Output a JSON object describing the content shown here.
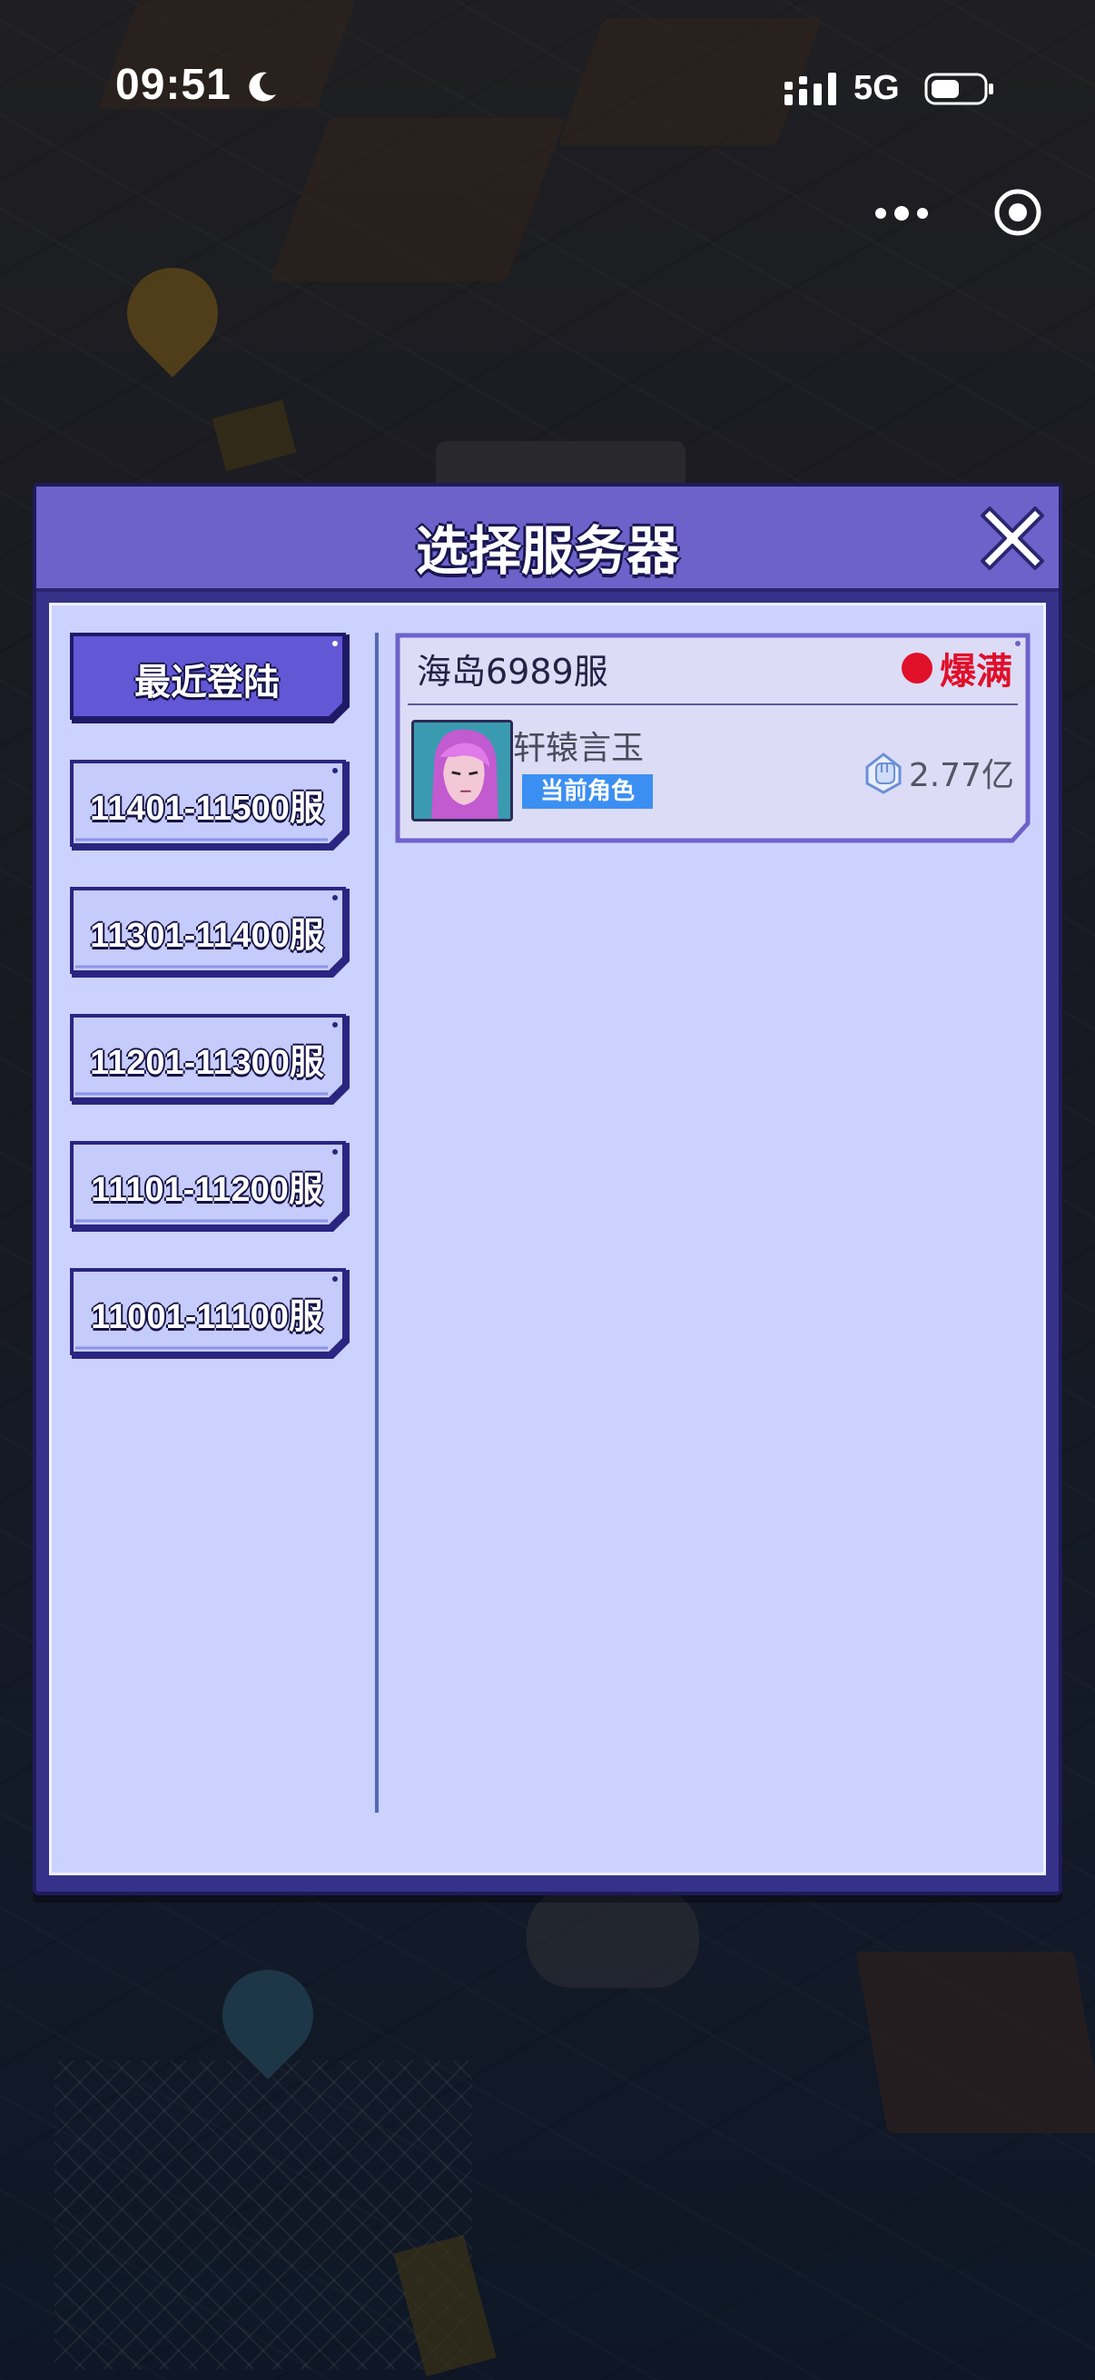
{
  "status_bar": {
    "time": "09:51",
    "network": "5G"
  },
  "dialog": {
    "title": "选择服务器",
    "groups": [
      {
        "label": "最近登陆",
        "selected": true
      },
      {
        "label": "11401-11500服",
        "selected": false
      },
      {
        "label": "11301-11400服",
        "selected": false
      },
      {
        "label": "11201-11300服",
        "selected": false
      },
      {
        "label": "11101-11200服",
        "selected": false
      },
      {
        "label": "11001-11100服",
        "selected": false
      }
    ],
    "server": {
      "name": "海岛6989服",
      "status": "爆满",
      "status_color": "#e0102a",
      "role_name": "轩辕言玉",
      "role_tag": "当前角色",
      "power": "2.77亿"
    }
  },
  "colors": {
    "header": "#6d62c9",
    "body": "#cbd2fe",
    "selected_tab": "#6258d6",
    "tab": "#c5cbfa",
    "tag": "#3c8ff2"
  }
}
